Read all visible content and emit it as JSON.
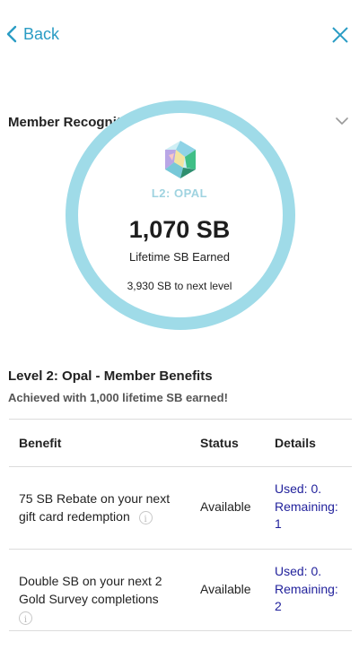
{
  "nav": {
    "back_label": "Back"
  },
  "recognition": {
    "section_title": "Member Recognition",
    "level_badge": "L2: OPAL",
    "sb_total": "1,070 SB",
    "sb_caption": "Lifetime SB Earned",
    "next_level_text": "3,930 SB to next level",
    "ring_color": "#9fdbe8",
    "accent_color": "#2a9cc4",
    "icons": {
      "gem": "opal-gem-icon",
      "expand": "chevron-down-icon",
      "close": "close-icon"
    }
  },
  "benefits": {
    "title": "Level 2: Opal - Member Benefits",
    "subtitle": "Achieved with 1,000 lifetime SB earned!",
    "columns": [
      "Benefit",
      "Status",
      "Details"
    ],
    "rows": [
      {
        "benefit": "75 SB Rebate on your next gift card redemption",
        "status": "Available",
        "used": "Used: 0.",
        "remaining_label": "Remaining:",
        "remaining_value": "1"
      },
      {
        "benefit": "Double SB on your next 2 Gold Survey completions",
        "status": "Available",
        "used": "Used: 0.",
        "remaining_label": "Remaining:",
        "remaining_value": "2"
      }
    ]
  }
}
